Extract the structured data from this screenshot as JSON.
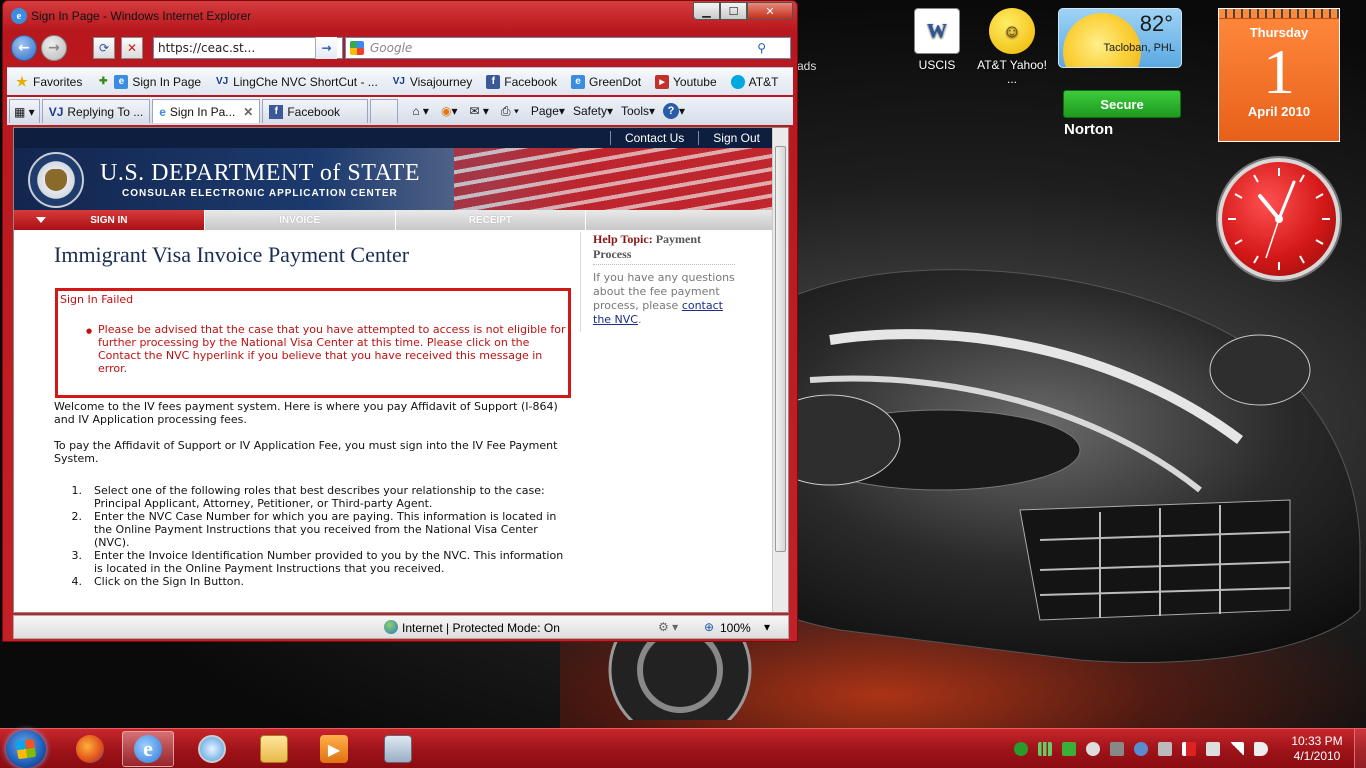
{
  "window": {
    "title": "Sign In Page - Windows Internet Explorer",
    "minimize": "▁",
    "maximize": "☐",
    "close": "✕"
  },
  "nav": {
    "address": "https://ceac.st...",
    "search_placeholder": "Google"
  },
  "favorites": {
    "label": "Favorites",
    "items": [
      "Sign In Page",
      "LingChe NVC ShortCut - ...",
      "Visajourney",
      "Facebook",
      "GreenDot",
      "Youtube",
      "AT&T"
    ]
  },
  "tabs": {
    "items": [
      "Replying To ...",
      "Sign In Pa...",
      "Facebook"
    ],
    "commands": [
      "Page",
      "Safety",
      "Tools"
    ]
  },
  "page": {
    "topnav": [
      "Contact Us",
      "Sign Out"
    ],
    "dept_title": "U.S. DEPARTMENT of STATE",
    "dept_subtitle": "CONSULAR ELECTRONIC APPLICATION CENTER",
    "steps": [
      "SIGN IN",
      "INVOICE",
      "RECEIPT"
    ],
    "heading": "Immigrant Visa Invoice Payment Center",
    "error_title": "Sign In Failed",
    "error_message": "Please be advised that the case that you have attempted to access is not eligible for further processing by the National Visa Center at this time. Please click on the Contact the NVC hyperlink if you believe that you have received this message in error.",
    "welcome": "Welcome to the IV fees payment system. Here is where you pay Affidavit of Support (I-864) and IV Application processing fees.",
    "instructions_intro": "To pay the Affidavit of Support or IV Application Fee, you must sign into the IV Fee Payment System.",
    "steps_list": [
      "Select one of the following roles that best describes your relationship to the case: Principal Applicant, Attorney, Petitioner, or Third-party Agent.",
      "Enter the NVC Case Number for which you are paying. This information is located in the Online Payment Instructions that you received from the National Visa Center (NVC).",
      "Enter the Invoice Identification Number provided to you by the NVC. This information is located in the Online Payment Instructions that you received.",
      "Click on the Sign In Button."
    ],
    "help_label": "Help Topic:",
    "help_topic": "Payment Process",
    "help_text": "If you have any questions about the fee payment process, please",
    "help_link": "contact the NVC",
    "help_end": "."
  },
  "status": {
    "zone": "Internet | Protected Mode: On",
    "zoom": "100%"
  },
  "desktop": {
    "icons": [
      {
        "label": "USCIS",
        "icon": "word-document-icon"
      },
      {
        "label": "AT&T Yahoo! ...",
        "icon": "yahoo-messenger-icon"
      }
    ],
    "partial_label": "ads",
    "weather": {
      "temp": "82°",
      "city": "Tacloban, PHL"
    },
    "norton": {
      "status": "Secure",
      "brand": "Norton"
    },
    "calendar": {
      "day": "Thursday",
      "date": "1",
      "month": "April 2010"
    }
  },
  "taskbar": {
    "time": "10:33 PM",
    "date": "4/1/2010"
  },
  "colors": {
    "accent": "#c7252a",
    "error": "#d31818",
    "navy": "#13264e"
  }
}
